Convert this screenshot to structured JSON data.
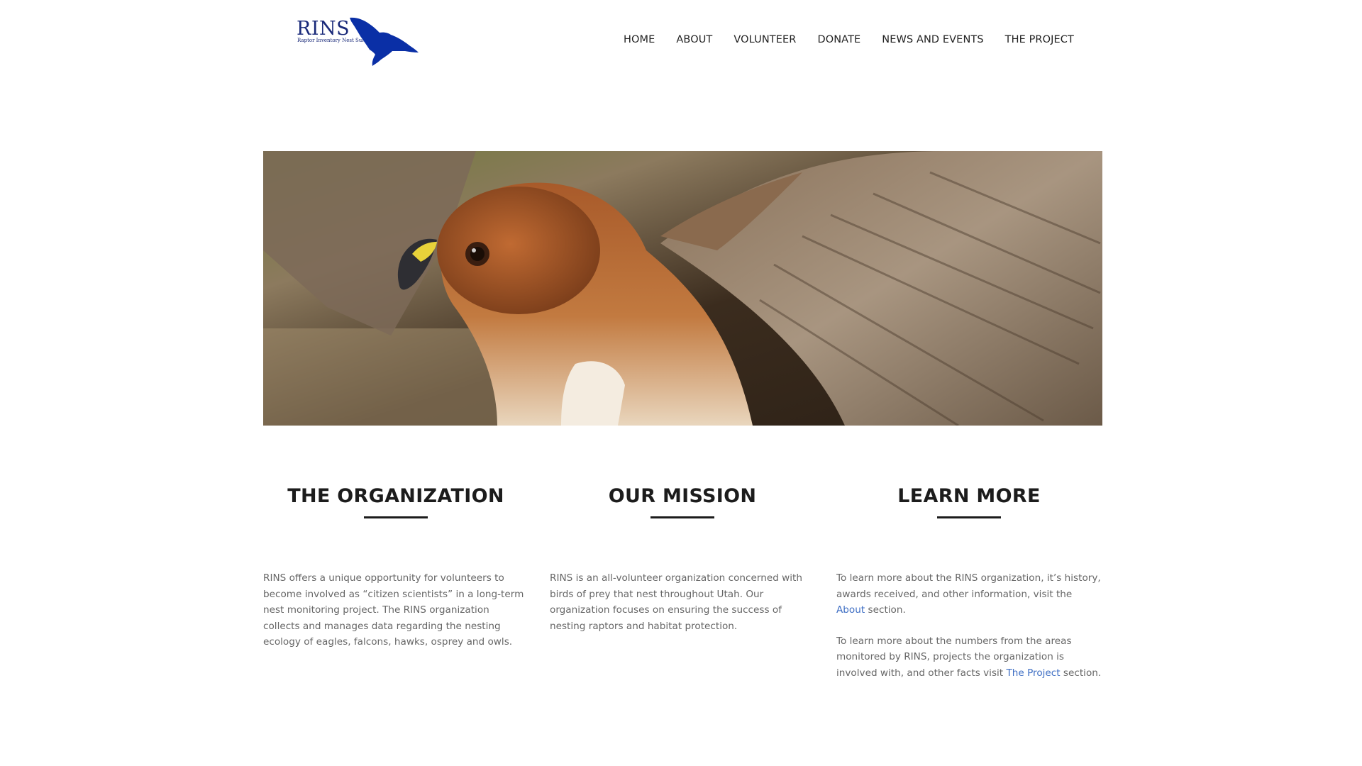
{
  "logo": {
    "title": "RINS",
    "subtitle": "Raptor Inventory Nest Survey"
  },
  "nav": {
    "items": [
      "HOME",
      "ABOUT",
      "VOLUNTEER",
      "DONATE",
      "NEWS AND EVENTS",
      "THE PROJECT"
    ]
  },
  "hero": {
    "image": "red-tailed-hawk-photo"
  },
  "columns": [
    {
      "heading": "THE ORGANIZATION",
      "paragraph": "RINS offers a unique opportunity for volunteers to become involved as “citizen scientists” in a long-term nest monitoring project. The RINS organization collects and manages data regarding the nesting ecology of eagles, falcons, hawks, osprey and owls."
    },
    {
      "heading": "OUR MISSION",
      "paragraph": "RINS is an all-volunteer organization concerned with birds of prey that nest throughout Utah. Our organization focuses on ensuring the success of nesting raptors and habitat protection."
    },
    {
      "heading": "LEARN MORE",
      "p1_before": "To learn more about the RINS organization, it’s history, awards received, and other information, visit the ",
      "p1_link": "About",
      "p1_after": " section.",
      "p2_before": "To learn more about the numbers from the areas monitored by RINS, projects the organization is involved with, and other facts visit ",
      "p2_link": "The Project",
      "p2_after": " section."
    }
  ],
  "colors": {
    "logo_blue": "#1a2a7a",
    "bird_blue": "#0a2fa6",
    "link_blue": "#3f6fc4",
    "heading": "#1c1c1c",
    "body_text": "#666666"
  }
}
